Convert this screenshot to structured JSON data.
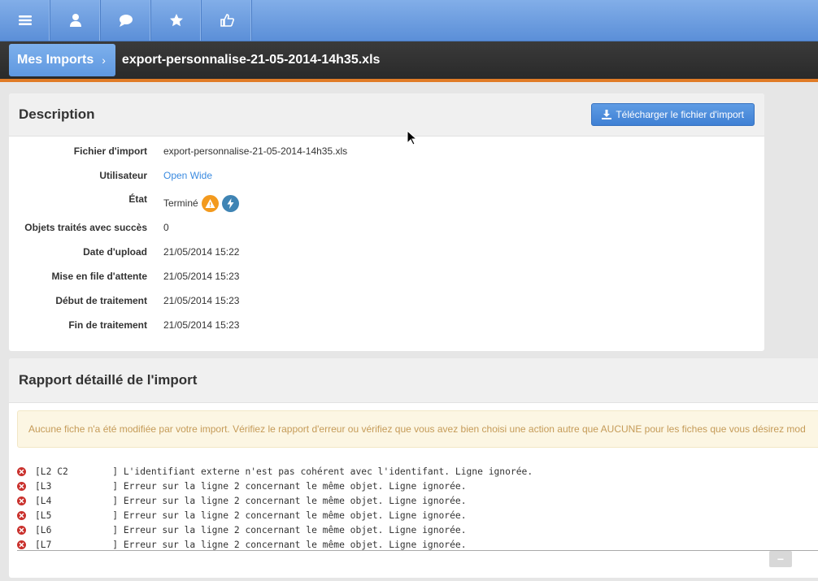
{
  "toolbar": {
    "buttons": [
      {
        "icon": "menu-icon"
      },
      {
        "icon": "user-icon"
      },
      {
        "icon": "chat-icon"
      },
      {
        "icon": "star-icon"
      },
      {
        "icon": "thumbs-up-icon"
      }
    ]
  },
  "breadcrumb": {
    "parent": "Mes Imports",
    "separator": "›",
    "current": "export-personnalise-21-05-2014-14h35.xls"
  },
  "description": {
    "title": "Description",
    "download_label": "Télécharger le fichier d'import",
    "fields": [
      {
        "label": "Fichier d'import",
        "value": "export-personnalise-21-05-2014-14h35.xls"
      },
      {
        "label": "Utilisateur",
        "value": "Open Wide"
      },
      {
        "label": "État",
        "value": "Terminé"
      },
      {
        "label": "Objets traités avec succès",
        "value": "0"
      },
      {
        "label": "Date d'upload",
        "value": "21/05/2014 15:22"
      },
      {
        "label": "Mise en file d'attente",
        "value": "21/05/2014 15:23"
      },
      {
        "label": "Début de traitement",
        "value": "21/05/2014 15:23"
      },
      {
        "label": "Fin de traitement",
        "value": "21/05/2014 15:23"
      }
    ]
  },
  "report": {
    "title": "Rapport détaillé de l'import",
    "alert": "Aucune fiche n'a été modifiée par votre import. Vérifiez le rapport d'erreur ou vérifiez que vous avez bien choisi une action autre que AUCUNE pour les fiches que vous désirez mod",
    "log": [
      "[L2 C2        ] L'identifiant externe n'est pas cohérent avec l'identifant. Ligne ignorée.",
      "[L3           ] Erreur sur la ligne 2 concernant le même objet. Ligne ignorée.",
      "[L4           ] Erreur sur la ligne 2 concernant le même objet. Ligne ignorée.",
      "[L5           ] Erreur sur la ligne 2 concernant le même objet. Ligne ignorée.",
      "[L6           ] Erreur sur la ligne 2 concernant le même objet. Ligne ignorée.",
      "[L7           ] Erreur sur la ligne 2 concernant le même objet. Ligne ignorée."
    ],
    "collapse_label": "−"
  },
  "colors": {
    "toolbar": "#6a9fe2",
    "accent_orange": "#e07b27",
    "link": "#3b8be0",
    "warning": "#f39a1e",
    "error": "#c9302c"
  }
}
